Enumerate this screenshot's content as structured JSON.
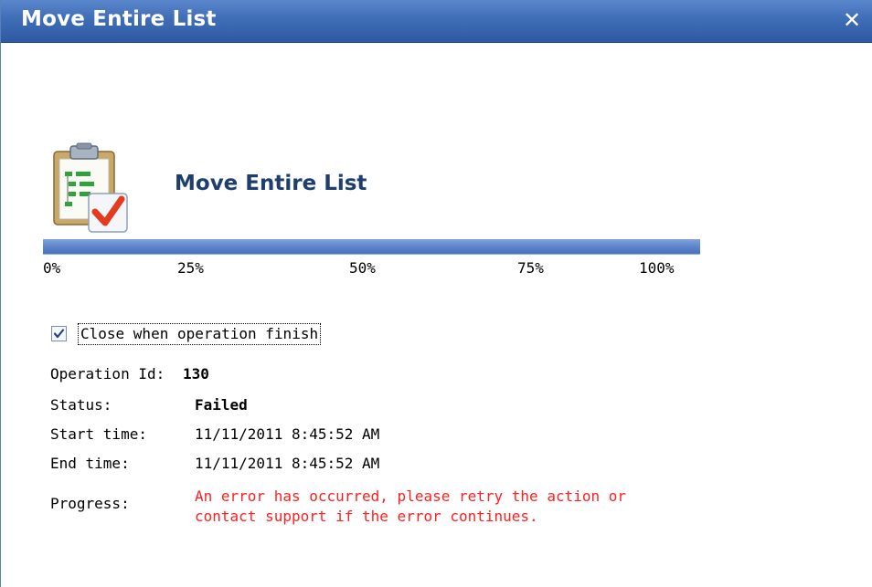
{
  "dialog": {
    "title": "Move Entire List",
    "close_icon": "close-icon"
  },
  "operation": {
    "icon": "clipboard-check-icon",
    "heading": "Move Entire List",
    "progress_percent": 100,
    "ticks": [
      "0%",
      "25%",
      "50%",
      "75%",
      "100%"
    ]
  },
  "options": {
    "close_when_finish_label": "Close when operation finish",
    "close_when_finish_checked": true
  },
  "details": {
    "operation_id_label": "Operation Id:",
    "operation_id_value": "130",
    "status_label": "Status:",
    "status_value": "Failed",
    "start_time_label": "Start time:",
    "start_time_value": "11/11/2011 8:45:52 AM",
    "end_time_label": "End time:",
    "end_time_value": "11/11/2011 8:45:52 AM",
    "progress_label": "Progress:",
    "progress_message_line1": "An error has occurred, please retry the action or",
    "progress_message_line2": "contact support if the error continues."
  },
  "colors": {
    "title_bar": "#3f6db6",
    "heading": "#1e3e6e",
    "error": "#ff2020",
    "progress": "#5b83c9"
  }
}
